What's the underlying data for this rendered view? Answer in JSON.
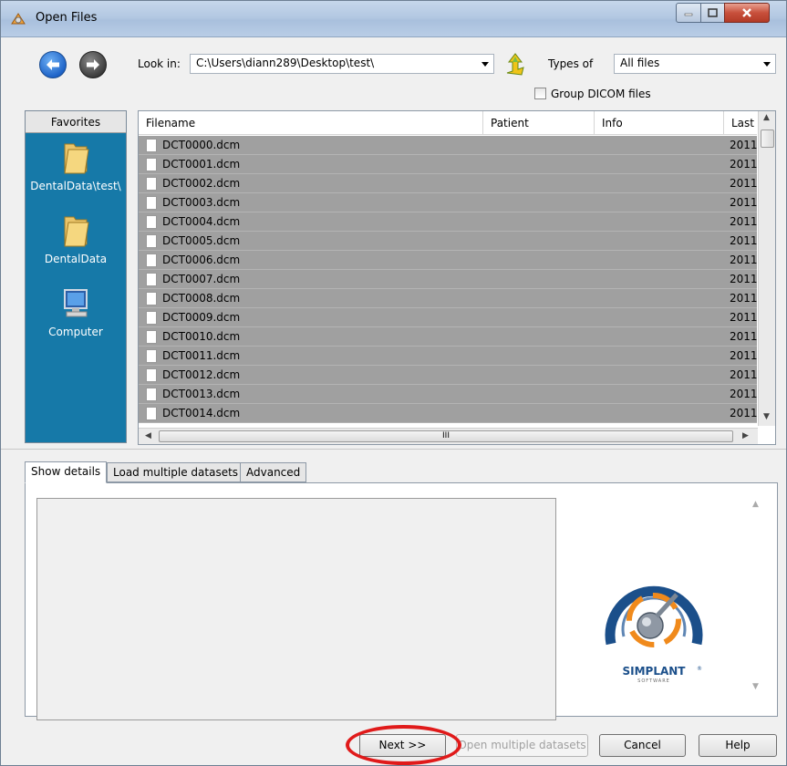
{
  "window": {
    "title": "Open Files"
  },
  "toolbar": {
    "look_in_label": "Look in:",
    "look_in_value": "C:\\Users\\diann289\\Desktop\\test\\",
    "types_label": "Types of",
    "types_value": "All files",
    "group_dicom_label": "Group DICOM files",
    "group_dicom_checked": false
  },
  "favorites": {
    "header": "Favorites",
    "items": [
      {
        "label": "DentalData\\test\\",
        "icon": "folder-icon"
      },
      {
        "label": "DentalData",
        "icon": "folder-icon"
      },
      {
        "label": "Computer",
        "icon": "computer-icon"
      }
    ]
  },
  "filelist": {
    "columns": [
      "Filename",
      "Patient",
      "Info",
      "Last"
    ],
    "rows": [
      {
        "name": "DCT0000.dcm",
        "last": "2011"
      },
      {
        "name": "DCT0001.dcm",
        "last": "2011"
      },
      {
        "name": "DCT0002.dcm",
        "last": "2011"
      },
      {
        "name": "DCT0003.dcm",
        "last": "2011"
      },
      {
        "name": "DCT0004.dcm",
        "last": "2011"
      },
      {
        "name": "DCT0005.dcm",
        "last": "2011"
      },
      {
        "name": "DCT0006.dcm",
        "last": "2011"
      },
      {
        "name": "DCT0007.dcm",
        "last": "2011"
      },
      {
        "name": "DCT0008.dcm",
        "last": "2011"
      },
      {
        "name": "DCT0009.dcm",
        "last": "2011"
      },
      {
        "name": "DCT0010.dcm",
        "last": "2011"
      },
      {
        "name": "DCT0011.dcm",
        "last": "2011"
      },
      {
        "name": "DCT0012.dcm",
        "last": "2011"
      },
      {
        "name": "DCT0013.dcm",
        "last": "2011"
      },
      {
        "name": "DCT0014.dcm",
        "last": "2011"
      }
    ],
    "hscroll_grip": "III"
  },
  "tabs": [
    {
      "label": "Show details",
      "active": true
    },
    {
      "label": "Load multiple datasets",
      "active": false
    },
    {
      "label": "Advanced",
      "active": false
    }
  ],
  "logo": {
    "brand": "SIMPLANT",
    "sub": "SOFTWARE",
    "trademark": "®"
  },
  "buttons": {
    "next": "Next >>",
    "open_multiple": "Open multiple datasets",
    "cancel": "Cancel",
    "help": "Help"
  },
  "colors": {
    "favorites_bg": "#1679a8",
    "row_selected": "#a0a0a0",
    "annotation": "#e01a1a",
    "logo_blue": "#1b4f8a",
    "logo_orange": "#f08a1c"
  }
}
